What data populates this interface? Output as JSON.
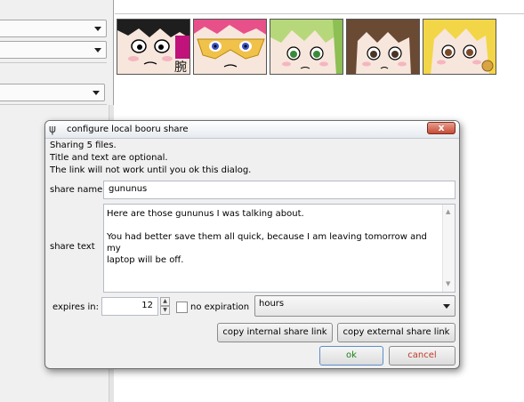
{
  "dialog": {
    "title": "configure local booru share",
    "title_icon": "psi-icon",
    "close_label": "x",
    "info_lines": [
      "Sharing 5 files.",
      "Title and text are optional.",
      "The link will not work until you ok this dialog."
    ],
    "share_name": {
      "label": "share name",
      "value": "gununus"
    },
    "share_text": {
      "label": "share text",
      "lines": [
        "Here are those gununus I was talking about.",
        "",
        "You had better save them all quick, because I am leaving tomorrow and my",
        "laptop will be off."
      ]
    },
    "expires": {
      "label": "expires in:",
      "value": "12"
    },
    "no_expiration": {
      "label": "no expiration",
      "checked": false
    },
    "unit_select": {
      "value": "hours"
    },
    "buttons": {
      "copy_internal": "copy internal share link",
      "copy_external": "copy external share link",
      "ok": "ok",
      "cancel": "cancel"
    },
    "colors": {
      "ok": "#1a7f1a",
      "cancel": "#c0392b",
      "close": "#c64a35"
    }
  },
  "thumbnails": [
    {
      "name": "thumbnail-1",
      "desc": "anime-face"
    },
    {
      "name": "thumbnail-2",
      "desc": "anime-face"
    },
    {
      "name": "thumbnail-3",
      "desc": "anime-face"
    },
    {
      "name": "thumbnail-4",
      "desc": "anime-face"
    },
    {
      "name": "thumbnail-5",
      "desc": "anime-face"
    }
  ]
}
